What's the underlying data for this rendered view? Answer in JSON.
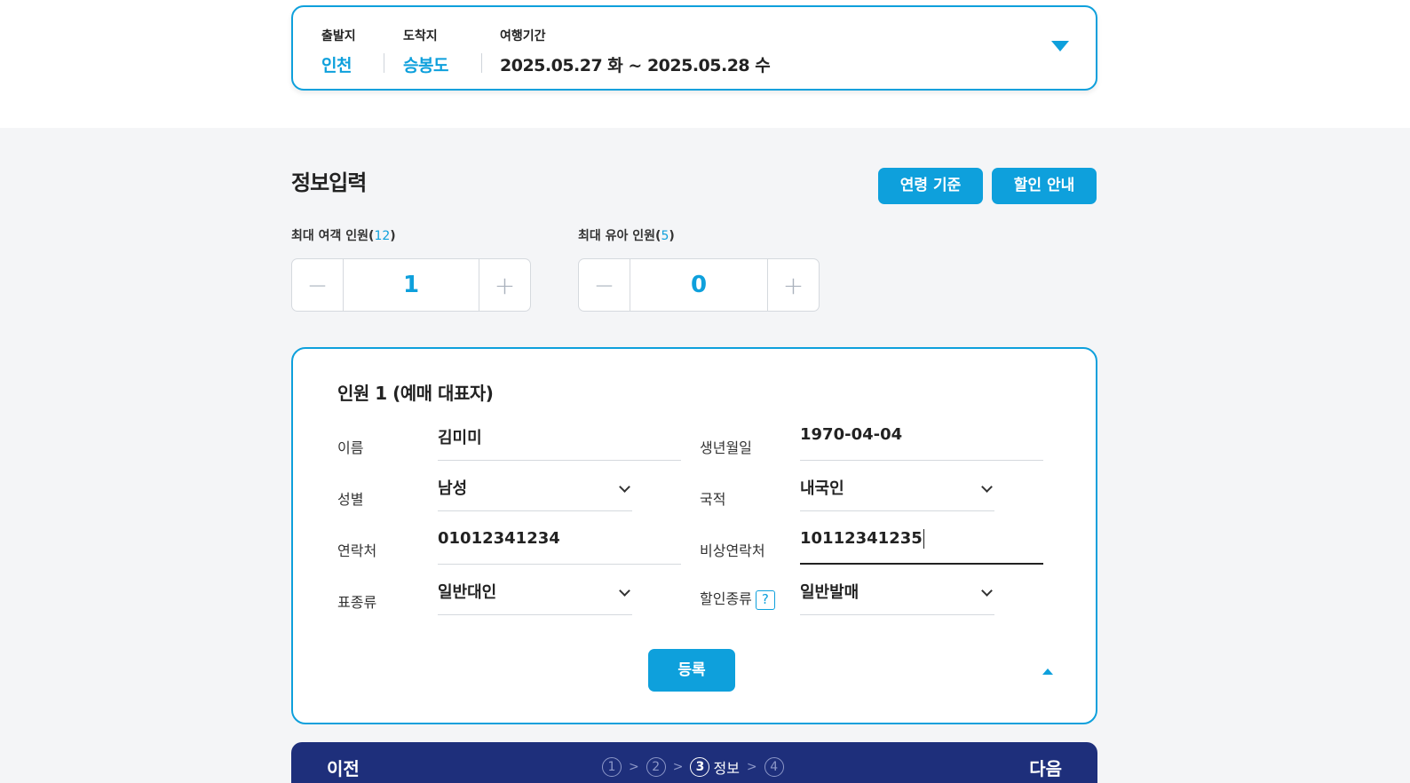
{
  "trip": {
    "origin_label": "출발지",
    "origin_value": "인천",
    "destination_label": "도착지",
    "destination_value": "승봉도",
    "period_label": "여행기간",
    "period_value": "2025.05.27 화 ~ 2025.05.28 수"
  },
  "section": {
    "title": "정보입력",
    "age_button": "연령 기준",
    "discount_button": "할인 안내"
  },
  "counts": {
    "max_passenger_label": "최대 여객 인원(",
    "max_passenger_num": "12",
    "max_infant_label": "최대 유아 인원(",
    "max_infant_num": "5",
    "close_paren": ")",
    "passenger_value": "1",
    "infant_value": "0"
  },
  "passenger": {
    "title": "인원 1 (예매 대표자)",
    "name_label": "이름",
    "name_value": "김미미",
    "birth_label": "생년월일",
    "birth_value": "1970-04-04",
    "gender_label": "성별",
    "gender_value": "남성",
    "nationality_label": "국적",
    "nationality_value": "내국인",
    "phone_label": "연락처",
    "phone_value": "01012341234",
    "emergency_label": "비상연락처",
    "emergency_value": "10112341235",
    "ticket_type_label": "표종류",
    "ticket_type_value": "일반대인",
    "discount_type_label": "할인종류",
    "discount_type_value": "일반발매",
    "help_glyph": "?",
    "register_button": "등록"
  },
  "bottom": {
    "prev": "이전",
    "next": "다음",
    "step1": "1",
    "step2": "2",
    "step3": "3",
    "step3_label": "정보",
    "step4": "4",
    "sep": ">"
  },
  "colors": {
    "accent": "#0ea0dc",
    "navy": "#1e2f7b"
  }
}
